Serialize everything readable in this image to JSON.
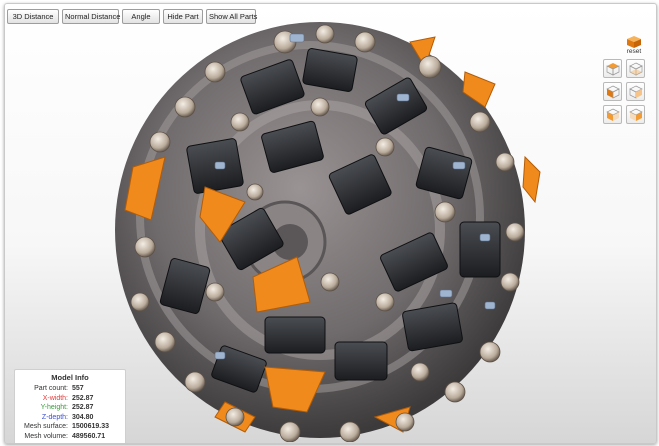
{
  "toolbar": {
    "buttons": [
      "3D Distance",
      "Normal Distance",
      "Angle",
      "Hide Part",
      "Show All Parts"
    ]
  },
  "view_controls": {
    "reset_label": "reset",
    "buttons": [
      "top-view",
      "bottom-view",
      "front-view",
      "back-view",
      "left-view",
      "right-view"
    ]
  },
  "model_info": {
    "title": "Model Info",
    "rows": [
      {
        "label": "Part count:",
        "value": "557",
        "color": "#333333"
      },
      {
        "label": "X-width:",
        "value": "252.87",
        "color": "#e23b3b"
      },
      {
        "label": "Y-height:",
        "value": "252.87",
        "color": "#3a9a3a"
      },
      {
        "label": "Z-depth:",
        "value": "304.80",
        "color": "#3b4fd6"
      },
      {
        "label": "Mesh surface:",
        "value": "1500619.33",
        "color": "#333333"
      },
      {
        "label": "Mesh volume:",
        "value": "489560.71",
        "color": "#333333"
      }
    ]
  },
  "colors": {
    "accent_orange": "#f08a1c",
    "motor_dark": "#2b2d30",
    "plate_gray": "#8d8788"
  }
}
